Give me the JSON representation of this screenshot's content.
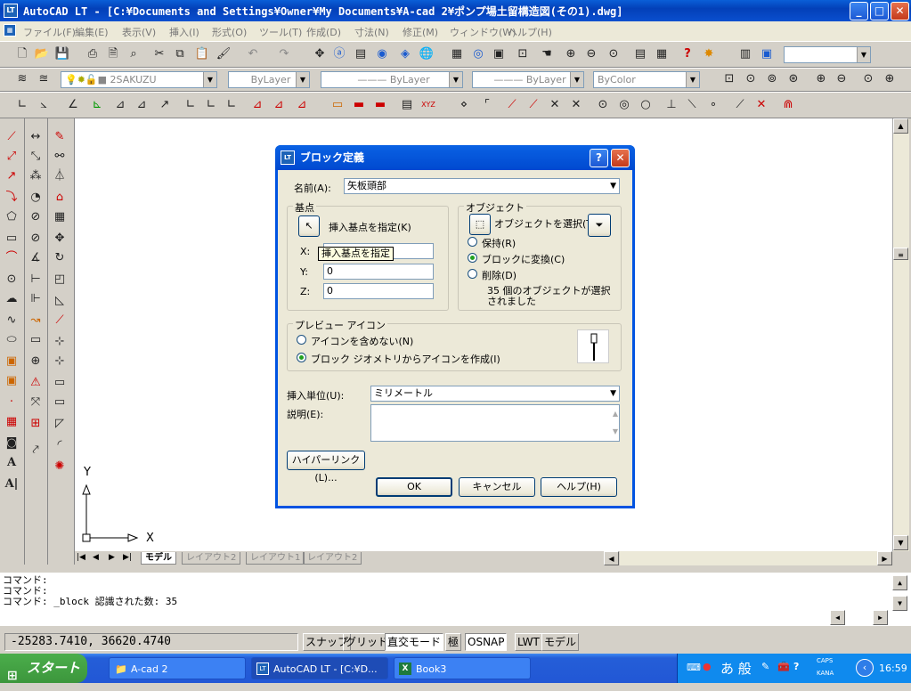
{
  "window": {
    "title": "AutoCAD LT - [C:¥Documents and Settings¥Owner¥My Documents¥A-cad 2¥ポンプ場土留構造図(その1).dwg]",
    "app_icon": "LT"
  },
  "menu": [
    "ファイル(F)",
    "編集(E)",
    "表示(V)",
    "挿入(I)",
    "形式(O)",
    "ツール(T)",
    "作成(D)",
    "寸法(N)",
    "修正(M)",
    "ウィンドウ(W)",
    "ヘルプ(H)"
  ],
  "properties_bar": {
    "layer": "2SAKUZU",
    "color": "ByLayer",
    "linetype": "ByLayer",
    "lineweight": "ByLayer",
    "plotstyle": "ByColor"
  },
  "layout_tabs": [
    "モデル",
    "レイアウト2",
    "レイアウト1",
    "レイアウト2"
  ],
  "command_lines": [
    "コマンド:",
    "コマンド:",
    "コマンド: _block 認識された数: 35"
  ],
  "status": {
    "coords": "-25283.7410, 36620.4740",
    "toggles": [
      "スナップ",
      "グリッド",
      "直交モード",
      "極",
      "OSNAP",
      "LWT",
      "モデル"
    ]
  },
  "ucs": {
    "x_label": "X",
    "y_label": "Y"
  },
  "dialog": {
    "title": "ブロック定義",
    "name_label": "名前(A):",
    "name_value": "矢板頭部",
    "basepoint": {
      "group_title": "基点",
      "pick_label": "挿入基点を指定(K)",
      "tooltip": "挿入基点を指定",
      "x_label": "X:",
      "y_label": "Y:",
      "z_label": "Z:",
      "x_value": "0",
      "y_value": "0",
      "z_value": "0"
    },
    "objects": {
      "group_title": "オブジェクト",
      "select_label": "オブジェクトを選択(T)",
      "retain_label": "保持(R)",
      "convert_label": "ブロックに変換(C)",
      "delete_label": "削除(D)",
      "selected_text": "35 個のオブジェクトが選択されました"
    },
    "preview": {
      "group_title": "プレビュー アイコン",
      "no_icon_label": "アイコンを含めない(N)",
      "create_icon_label": "ブロック ジオメトリからアイコンを作成(I)"
    },
    "units_label": "挿入単位(U):",
    "units_value": "ミリメートル",
    "description_label": "説明(E):",
    "hyperlink_button": "ハイパーリンク(L)...",
    "ok_button": "OK",
    "cancel_button": "キャンセル",
    "help_button": "ヘルプ(H)"
  },
  "taskbar": {
    "start": "スタート",
    "tasks": [
      "A-cad 2",
      "AutoCAD LT - [C:¥D...",
      "Book3"
    ],
    "ime": "あ 般",
    "caps": "CAPS",
    "kana": "KANA",
    "clock": "16:59"
  }
}
